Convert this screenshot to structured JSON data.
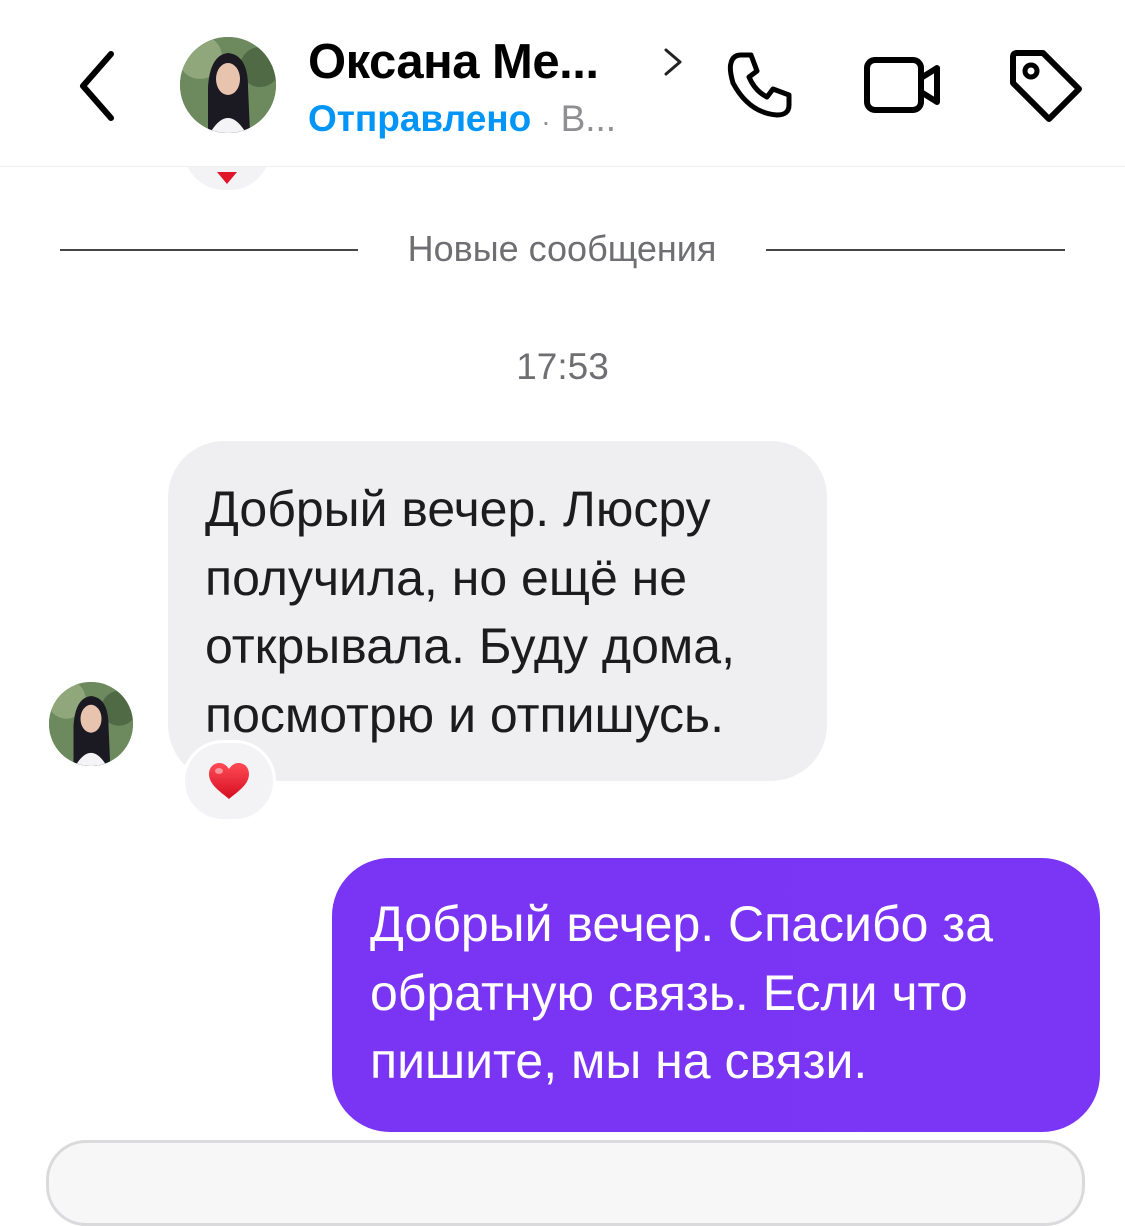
{
  "header": {
    "contact_name": "Оксана Ме...",
    "status_sent": "Отправлено",
    "status_separator": "·",
    "status_extra": "В...",
    "icons": [
      "back-chevron-icon",
      "phone-icon",
      "video-camera-icon",
      "tag-icon"
    ]
  },
  "conversation": {
    "divider_label": "Новые сообщения",
    "timestamp": "17:53",
    "messages": [
      {
        "direction": "incoming",
        "text": "Добрый вечер. Люсру получила, но ещё не открывала. Буду дома, посмотрю и отпишусь.",
        "reaction": "❤️"
      },
      {
        "direction": "outgoing",
        "text": "Добрый вечер. Спасибо за обратную связь. Если что пишите, мы на связи."
      }
    ]
  },
  "colors": {
    "sent_status": "#0095f6",
    "outgoing_bubble": "#7b36f5",
    "incoming_bubble": "#efeff1",
    "heart": "#e0152b"
  }
}
